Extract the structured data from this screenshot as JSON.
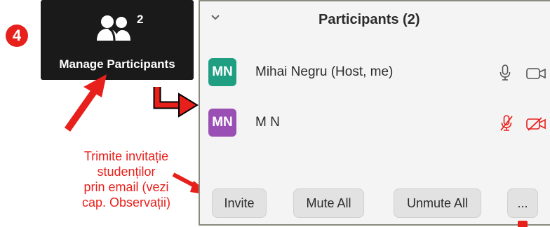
{
  "step": {
    "number": "4"
  },
  "toolbar_button": {
    "icon": "participants-icon",
    "count": "2",
    "label": "Manage Participants"
  },
  "caption": {
    "lines": [
      "Trimite invitație",
      "studenților",
      "prin email (vezi",
      "cap. Observații)"
    ],
    "color": "#e8201c"
  },
  "panel": {
    "title": "Participants (2)",
    "participants": [
      {
        "initials": "MN",
        "name": "Mihai Negru (Host, me)",
        "avatar_color": "#1f9e82",
        "audio": "mic-icon",
        "video": "camera-icon"
      },
      {
        "initials": "MN",
        "name": "M N",
        "avatar_color": "#9a4fb5",
        "audio": "mic-muted-icon",
        "video": "camera-off-icon"
      }
    ],
    "buttons": {
      "invite": "Invite",
      "mute_all": "Mute All",
      "unmute_all": "Unmute All",
      "more": "..."
    }
  },
  "colors": {
    "annotation_red": "#e8201c",
    "toolbar_bg": "#1a1a1a",
    "panel_bg": "#f4f4f4"
  }
}
